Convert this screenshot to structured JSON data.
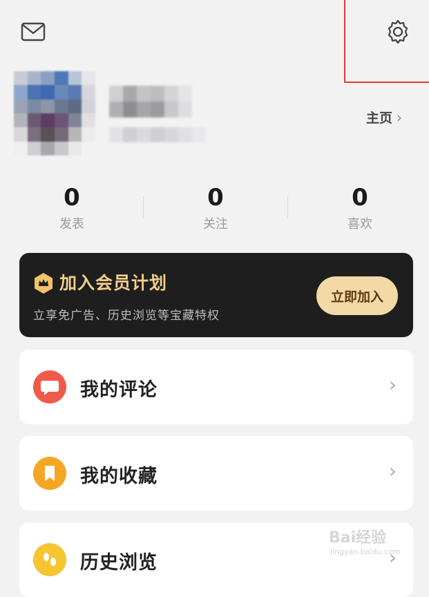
{
  "header": {
    "mail_icon": "mail-icon",
    "settings_icon": "gear-icon",
    "highlight_color": "#e53935"
  },
  "profile": {
    "homepage_label": "主页",
    "homepage_chevron": "›"
  },
  "stats": [
    {
      "value": "0",
      "label": "发表"
    },
    {
      "value": "0",
      "label": "关注"
    },
    {
      "value": "0",
      "label": "喜欢"
    }
  ],
  "member": {
    "title": "加入会员计划",
    "subtitle": "立享免广告、历史浏览等宝藏特权",
    "button": "立即加入",
    "accent": "#f2cf8b"
  },
  "menu": [
    {
      "label": "我的评论",
      "icon": "comment-icon",
      "color": "#f05a4a",
      "arrow": "›"
    },
    {
      "label": "我的收藏",
      "icon": "bookmark-icon",
      "color": "#f5a623",
      "arrow": "›"
    },
    {
      "label": "历史浏览",
      "icon": "footprint-icon",
      "color": "#f7c531",
      "arrow": "›"
    }
  ],
  "watermark": {
    "brand": "Bai经验",
    "url": "jingyan.baidu.com"
  }
}
